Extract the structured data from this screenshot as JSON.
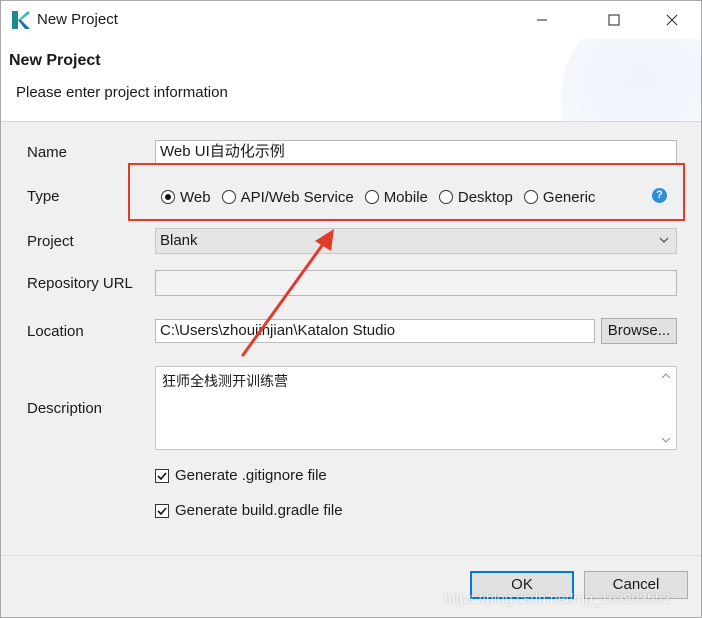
{
  "window": {
    "title": "New Project",
    "controls": {
      "minimize": "minimize",
      "maximize": "maximize",
      "close": "close"
    }
  },
  "header": {
    "title": "New Project",
    "subtitle": "Please enter project information"
  },
  "form": {
    "name": {
      "label": "Name",
      "value": "Web UI自动化示例"
    },
    "type": {
      "label": "Type",
      "options": [
        "Web",
        "API/Web Service",
        "Mobile",
        "Desktop",
        "Generic"
      ],
      "selected": "Web"
    },
    "project": {
      "label": "Project",
      "value": "Blank"
    },
    "repository_url": {
      "label": "Repository URL",
      "value": ""
    },
    "location": {
      "label": "Location",
      "value": "C:\\Users\\zhoujinjian\\Katalon Studio",
      "browse_label": "Browse..."
    },
    "description": {
      "label": "Description",
      "value": "狂师全栈测开训练营"
    },
    "gitignore": {
      "label": "Generate .gitignore file",
      "checked": true
    },
    "build_gradle": {
      "label": "Generate build.gradle file",
      "checked": true
    }
  },
  "footer": {
    "ok_label": "OK",
    "cancel_label": "Cancel"
  },
  "watermark": "https://blog.csdn.net/mp_163903553",
  "colors": {
    "annotation": "#e23b2b",
    "accent": "#0078d7",
    "help": "#2f8ddb"
  }
}
